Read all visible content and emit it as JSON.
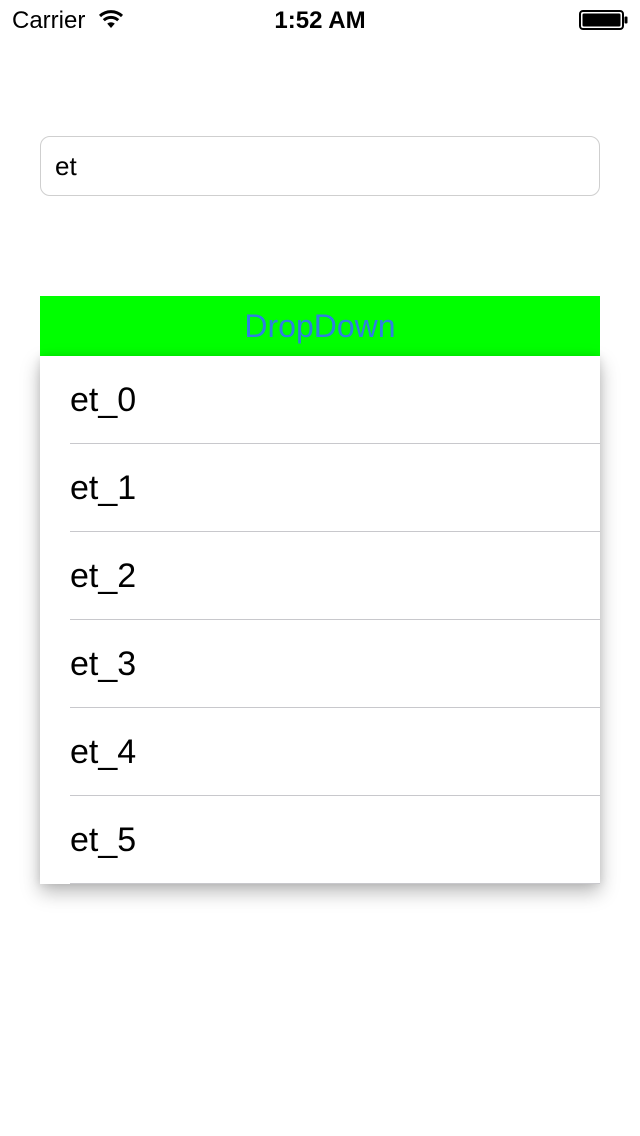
{
  "status_bar": {
    "carrier": "Carrier",
    "time": "1:52 AM",
    "icons": {
      "wifi": "wifi-icon",
      "battery": "battery-icon"
    }
  },
  "text_field": {
    "value": "et",
    "placeholder": ""
  },
  "dropdown": {
    "button_label": "DropDown",
    "button_background": "#00ff00",
    "button_text_color": "#2f7fe0",
    "items": [
      "et_0",
      "et_1",
      "et_2",
      "et_3",
      "et_4",
      "et_5"
    ]
  }
}
